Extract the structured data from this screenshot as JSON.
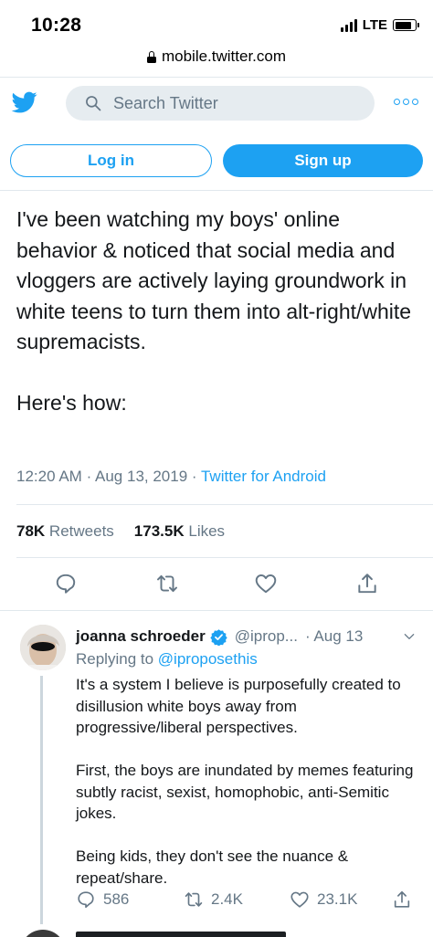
{
  "status_bar": {
    "time": "10:28",
    "network": "LTE",
    "battery_level": 0.85
  },
  "browser": {
    "url": "mobile.twitter.com"
  },
  "header": {
    "search_placeholder": "Search Twitter"
  },
  "auth": {
    "login_label": "Log in",
    "signup_label": "Sign up"
  },
  "tweet": {
    "text": "I've been watching my boys' online behavior & noticed that social media and vloggers are actively laying groundwork in white teens to turn them into alt-right/white supremacists.\n\nHere's how:",
    "time": "12:20 AM",
    "date": "Aug 13, 2019",
    "source": "Twitter for Android",
    "retweets_count": "78K",
    "retweets_label": "Retweets",
    "likes_count": "173.5K",
    "likes_label": "Likes"
  },
  "reply": {
    "name": "joanna schroeder",
    "handle": "@iprop...",
    "date": "· Aug 13",
    "replying_prefix": "Replying to",
    "replying_to": "@iproposethis",
    "text": "It's a system I believe is purposefully created to disillusion white boys away from progressive/liberal perspectives.\n\nFirst, the boys are inundated by memes featuring subtly racist, sexist, homophobic, anti-Semitic jokes.\n\nBeing kids, they don't see the nuance & repeat/share.",
    "replies": "586",
    "retweets": "2.4K",
    "likes": "23.1K"
  },
  "colors": {
    "brand": "#1da1f2",
    "text": "#14171a",
    "muted": "#657786",
    "border": "#e1e8ed"
  }
}
